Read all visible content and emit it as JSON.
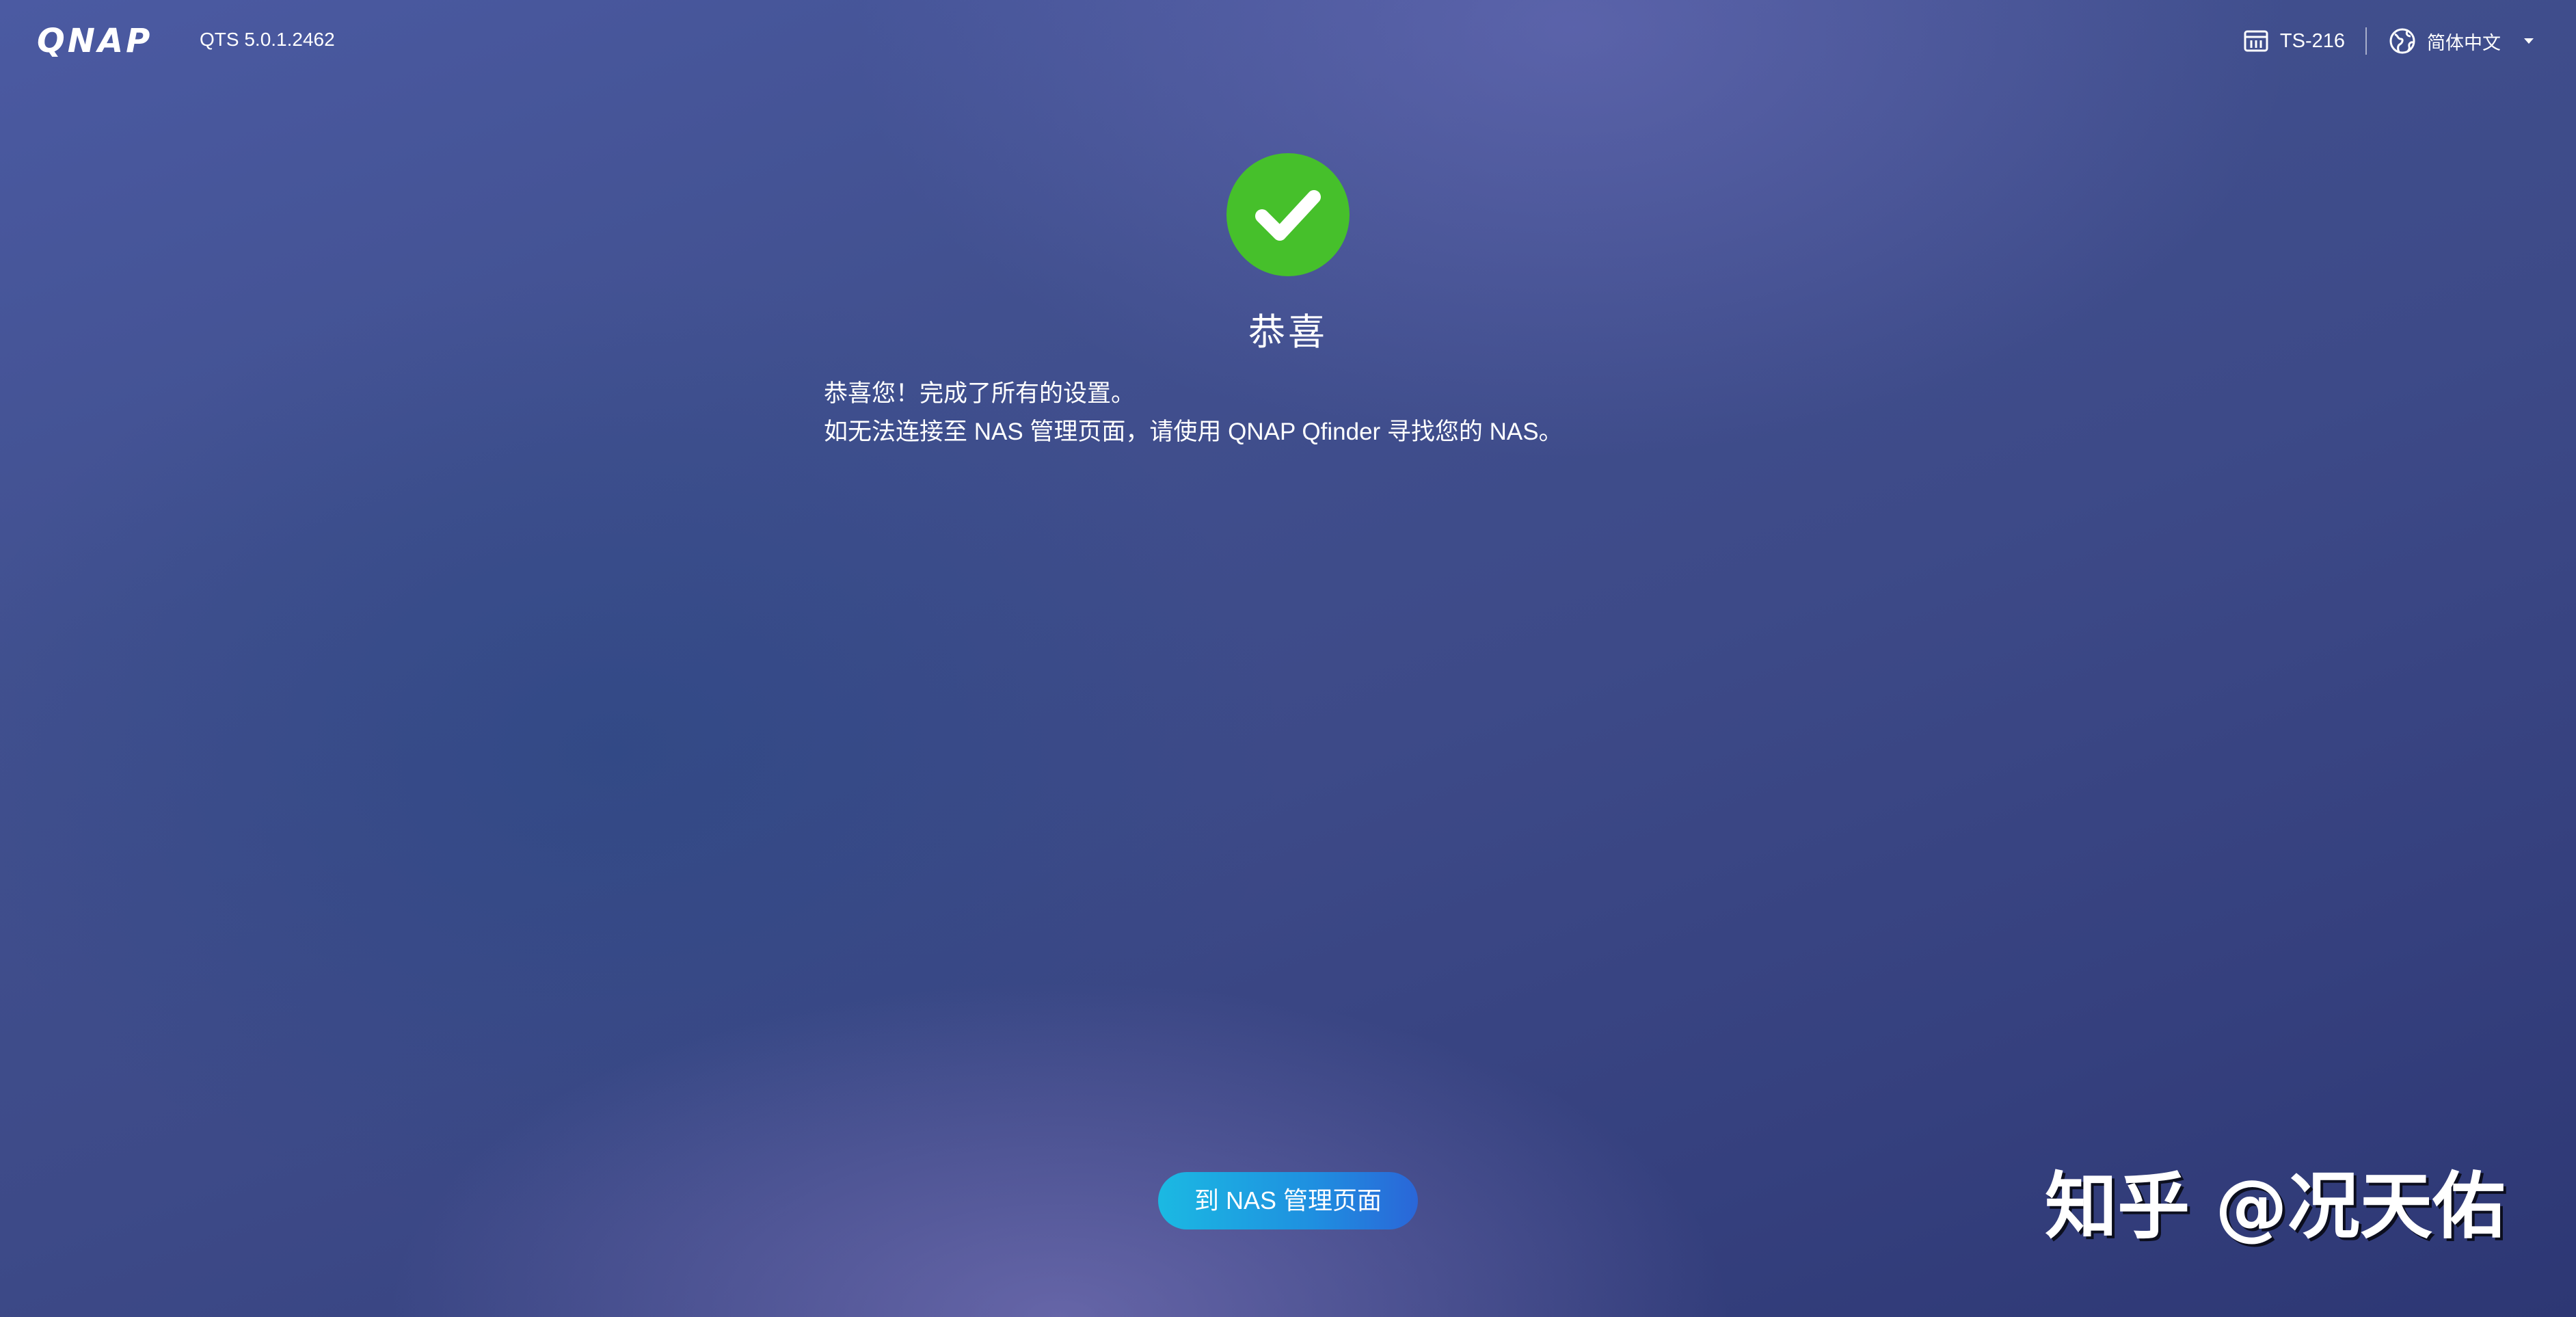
{
  "header": {
    "logo": "QNAP",
    "version": "QTS 5.0.1.2462",
    "model": "TS-216",
    "language": "简体中文",
    "icons": {
      "model": "nas-device-icon",
      "language": "globe-icon",
      "language_menu": "chevron-down-icon"
    }
  },
  "main": {
    "status_icon": "check-circle-icon",
    "title": "恭喜",
    "message_line1": "恭喜您！完成了所有的设置。",
    "message_line2": "如无法连接至 NAS 管理页面，请使用 QNAP Qfinder 寻找您的 NAS。",
    "button_label": "到 NAS 管理页面"
  },
  "watermark": "知乎 @况天佑",
  "colors": {
    "success": "#46c02b",
    "button_start": "#1bb9e2",
    "button_end": "#2a66d8",
    "background": "#3d4a88"
  }
}
